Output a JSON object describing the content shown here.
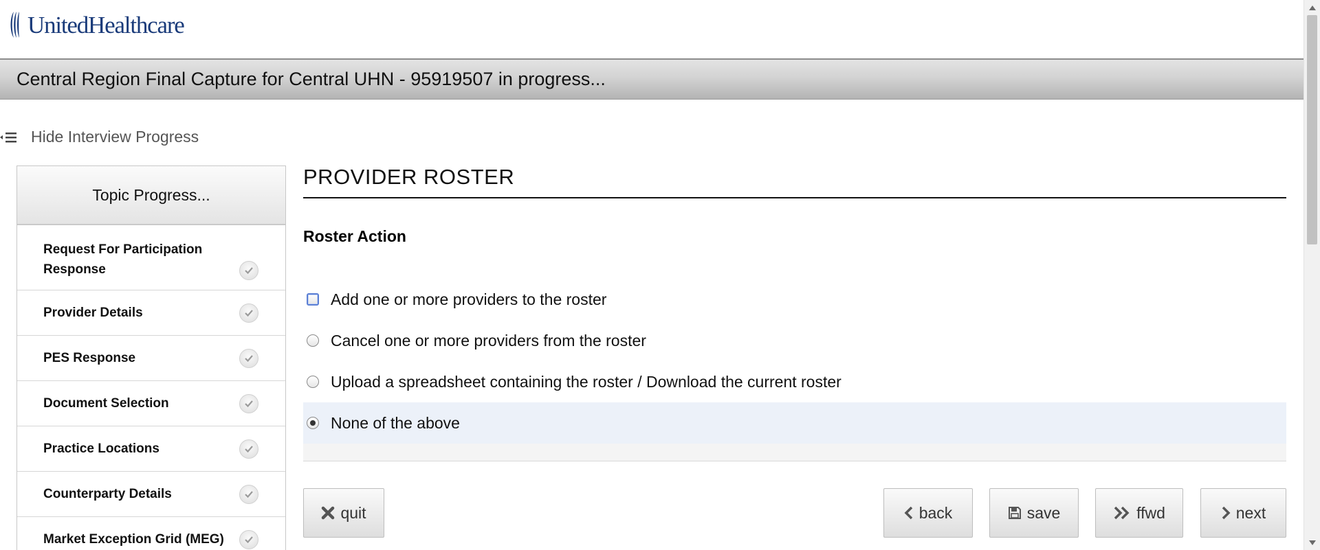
{
  "brand": {
    "name": "UnitedHealthcare"
  },
  "title_bar": {
    "text": "Central Region Final Capture for Central UHN - 95919507 in progress..."
  },
  "progress_toggle": {
    "label": "Hide Interview Progress"
  },
  "sidebar": {
    "header": "Topic Progress...",
    "topics": [
      {
        "label": "Request For Participation Response",
        "status": "complete"
      },
      {
        "label": "Provider Details",
        "status": "complete"
      },
      {
        "label": "PES Response",
        "status": "complete"
      },
      {
        "label": "Document Selection",
        "status": "complete"
      },
      {
        "label": "Practice Locations",
        "status": "complete"
      },
      {
        "label": "Counterparty Details",
        "status": "complete"
      },
      {
        "label": "Market Exception Grid (MEG)",
        "status": "complete"
      }
    ]
  },
  "main": {
    "section_title": "PROVIDER ROSTER",
    "question": "Roster Action",
    "options": [
      {
        "label": "Add one or more providers to the roster",
        "selected": false,
        "focused": true
      },
      {
        "label": "Cancel one or more providers from the roster",
        "selected": false
      },
      {
        "label": "Upload a spreadsheet containing the roster / Download the current roster",
        "selected": false
      },
      {
        "label": "None of the above",
        "selected": true
      }
    ]
  },
  "buttons": {
    "quit": {
      "label": "quit",
      "icon": "close-icon"
    },
    "back": {
      "label": "back",
      "icon": "chevron-left-icon"
    },
    "save": {
      "label": "save",
      "icon": "floppy-disk-icon"
    },
    "ffwd": {
      "label": "ffwd",
      "icon": "double-chevron-right-icon"
    },
    "next": {
      "label": "next",
      "icon": "chevron-right-icon"
    }
  },
  "colors": {
    "brand_blue": "#1a3b7a",
    "selected_row": "#ecf1f9",
    "focus_ring": "#5b7fd4"
  }
}
